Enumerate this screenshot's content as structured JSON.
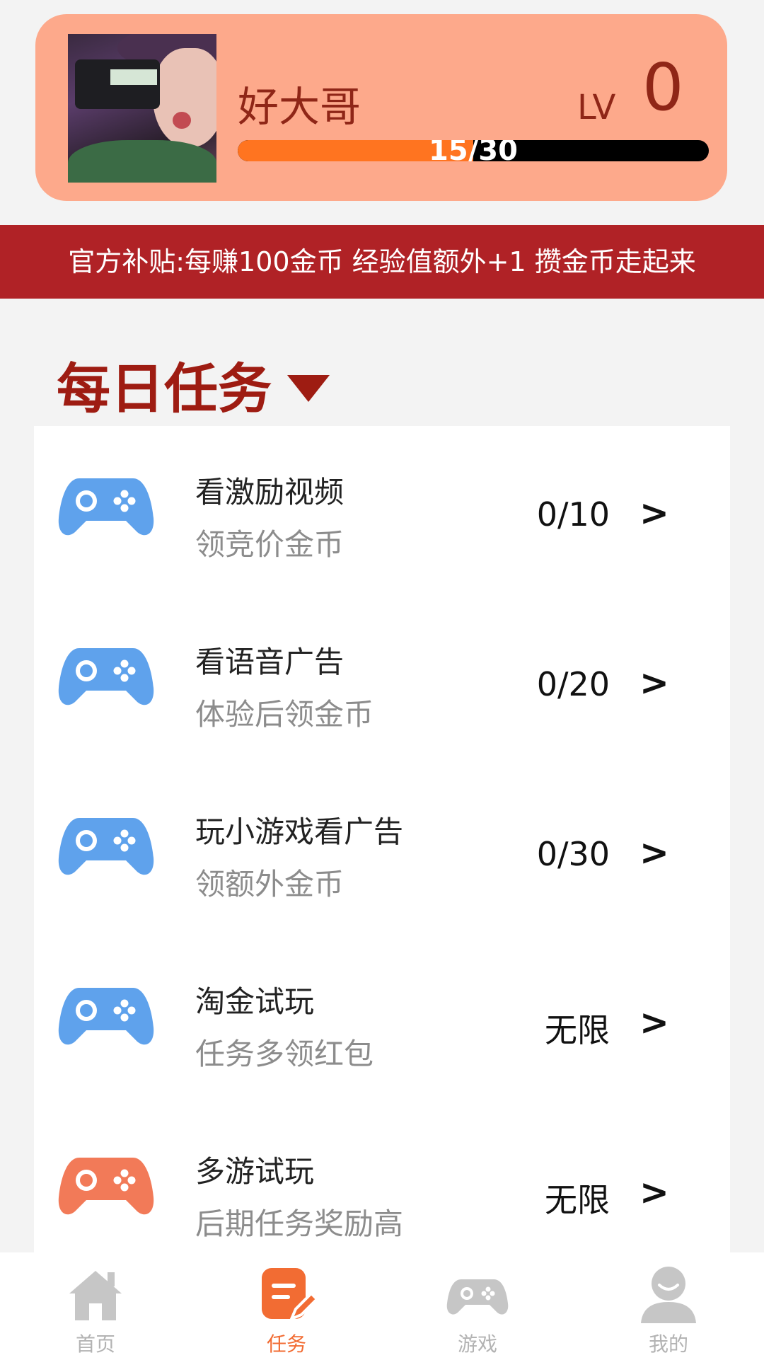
{
  "profile": {
    "username": "好大哥",
    "level_label": "LV",
    "level_value": "0",
    "progress_text": "15/30",
    "progress_fraction": 0.5
  },
  "banner": {
    "text": "官方补贴:每赚100金币 经验值额外+1 攒金币走起来"
  },
  "section": {
    "title": "每日任务"
  },
  "tasks": [
    {
      "title": "看激励视频",
      "subtitle": "领竞价金币",
      "count": "0/10",
      "icon": "gamepad-icon",
      "icon_color": "#5fa2ec"
    },
    {
      "title": "看语音广告",
      "subtitle": "体验后领金币",
      "count": "0/20",
      "icon": "gamepad-icon",
      "icon_color": "#5fa2ec"
    },
    {
      "title": "玩小游戏看广告",
      "subtitle": "领额外金币",
      "count": "0/30",
      "icon": "gamepad-icon",
      "icon_color": "#5fa2ec"
    },
    {
      "title": "淘金试玩",
      "subtitle": "任务多领红包",
      "count": "无限",
      "icon": "gamepad-icon",
      "icon_color": "#5fa2ec"
    },
    {
      "title": "多游试玩",
      "subtitle": "后期任务奖励高",
      "count": "无限",
      "icon": "gamepad-icon",
      "icon_color": "#f27a58"
    }
  ],
  "arrow_symbol": ">",
  "nav": {
    "items": [
      {
        "label": "首页",
        "icon": "home-icon"
      },
      {
        "label": "任务",
        "icon": "task-edit-icon",
        "active": true
      },
      {
        "label": "游戏",
        "icon": "gamepad-icon"
      },
      {
        "label": "我的",
        "icon": "user-icon"
      }
    ]
  },
  "colors": {
    "card_bg": "#fda98b",
    "banner_bg": "#b02226",
    "accent": "#9e1c12",
    "progress_fill": "#ff7420",
    "nav_active": "#f26c33"
  }
}
